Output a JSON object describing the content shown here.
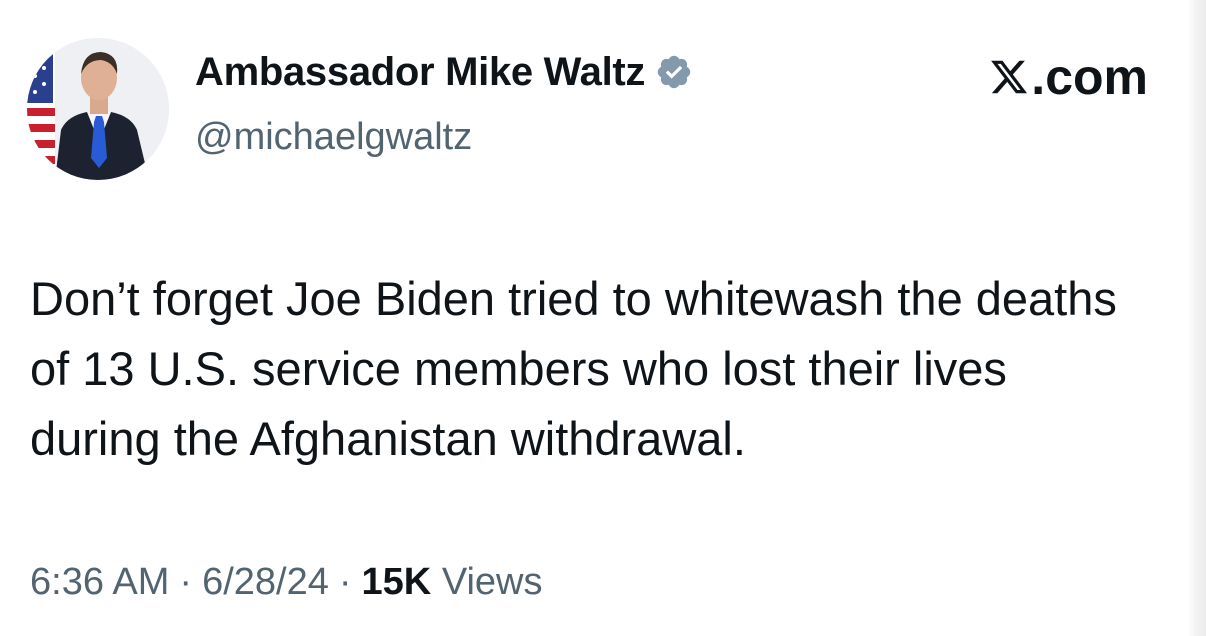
{
  "author": {
    "display_name": "Ambassador Mike Waltz",
    "handle": "@michaelgwaltz",
    "verified_icon": "verified-badge-icon",
    "verified_color": "#829aab"
  },
  "brand": {
    "suffix": ".com",
    "icon": "x-logo-icon"
  },
  "tweet": {
    "text": "Don’t forget Joe Biden tried to whitewash the deaths of 13 U.S. service members who lost their lives during the Afghanistan withdrawal."
  },
  "meta": {
    "time": "6:36 AM",
    "separator": "·",
    "date": "6/28/24",
    "views_count": "15K",
    "views_label": "Views"
  },
  "colors": {
    "text_primary": "#0f1419",
    "text_secondary": "#536471"
  }
}
